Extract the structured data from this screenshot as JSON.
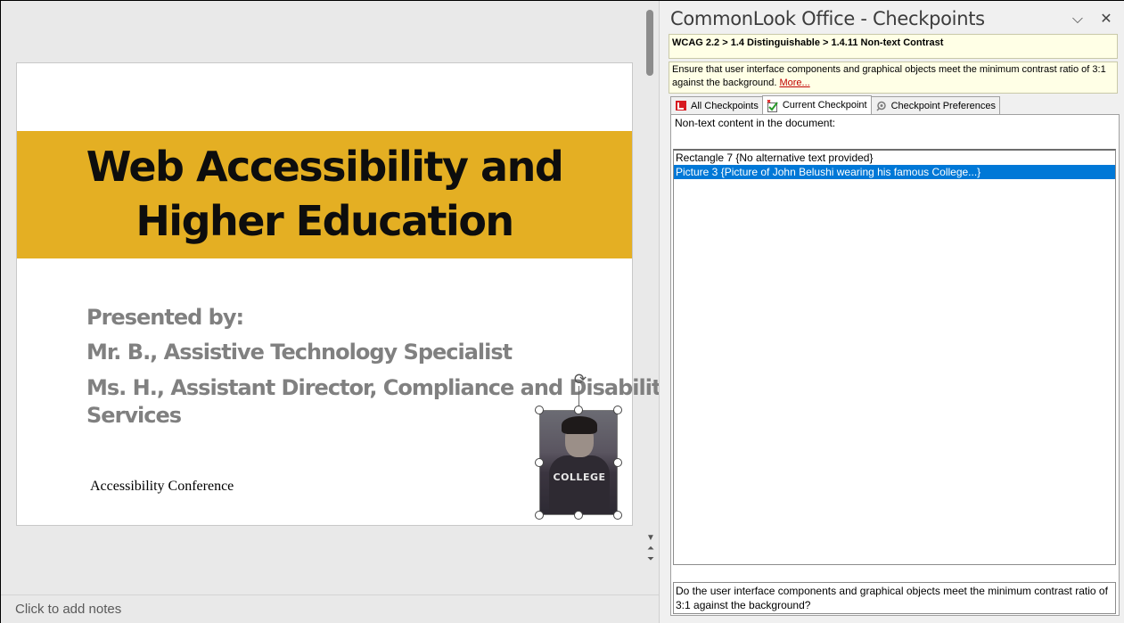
{
  "slide": {
    "title_line1": "Web Accessibility and",
    "title_line2": "Higher Education",
    "presenters": [
      "Presented by:",
      "Mr. B., Assistive Technology Specialist",
      "Ms. H., Assistant Director, Compliance and Disabilit",
      "Services"
    ],
    "footer_text": "Accessibility Conference",
    "photo_caption": "COLLEGE",
    "title_band_color": "#e4af23"
  },
  "notes": {
    "placeholder": "Click to add notes"
  },
  "pane": {
    "title": "CommonLook Office - Checkpoints",
    "breadcrumb": "WCAG 2.2 > 1.4 Distinguishable > 1.4.11 Non-text Contrast",
    "description": "Ensure that user interface components and graphical objects meet the minimum contrast ratio of 3:1 against the background.",
    "more_link": "More...",
    "tabs": [
      {
        "label": "All Checkpoints",
        "icon": "all-checkpoints-icon"
      },
      {
        "label": "Current Checkpoint",
        "icon": "current-checkpoint-icon",
        "active": true
      },
      {
        "label": "Checkpoint Preferences",
        "icon": "preferences-icon"
      }
    ],
    "list_label": "Non-text content in the document:",
    "items": [
      {
        "text": "Rectangle 7 {No alternative text provided}",
        "selected": false
      },
      {
        "text": "Picture 3 {Picture of John Belushi wearing his famous College...}",
        "selected": true
      }
    ],
    "question": "Do the user interface components and graphical objects meet the minimum contrast ratio of 3:1 against the background?"
  },
  "colors": {
    "selection": "#0078d7",
    "info_bg": "#ffffe6",
    "link": "#c00000"
  }
}
